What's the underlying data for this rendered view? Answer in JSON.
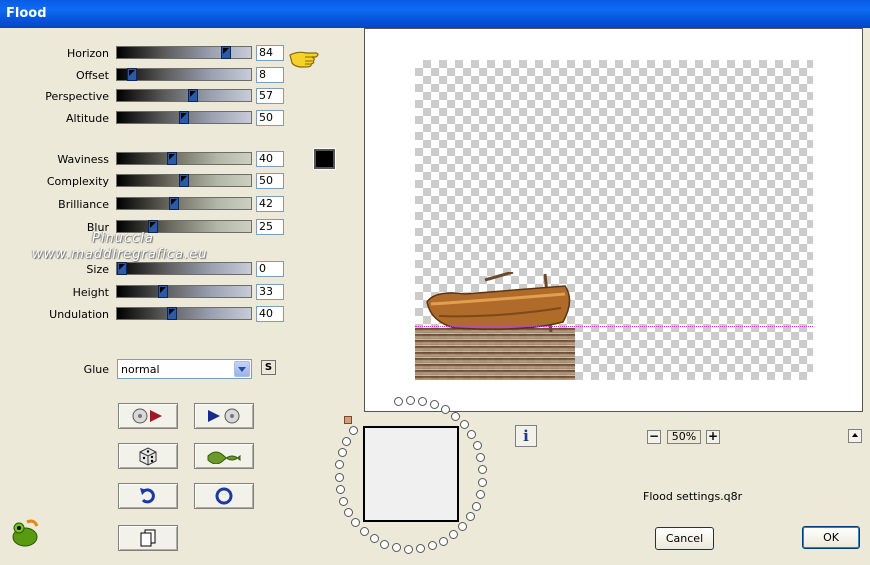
{
  "window": {
    "title": "Flood"
  },
  "sliders": [
    {
      "id": "horizon",
      "label": "Horizon",
      "value": "84"
    },
    {
      "id": "offset",
      "label": "Offset",
      "value": "8"
    },
    {
      "id": "perspective",
      "label": "Perspective",
      "value": "57"
    },
    {
      "id": "altitude",
      "label": "Altitude",
      "value": "50"
    },
    {
      "id": "waviness",
      "label": "Waviness",
      "value": "40"
    },
    {
      "id": "complexity",
      "label": "Complexity",
      "value": "50"
    },
    {
      "id": "brilliance",
      "label": "Brilliance",
      "value": "42"
    },
    {
      "id": "blur",
      "label": "Blur",
      "value": "25"
    },
    {
      "id": "size",
      "label": "Size",
      "value": "0"
    },
    {
      "id": "height",
      "label": "Height",
      "value": "33"
    },
    {
      "id": "undulation",
      "label": "Undulation",
      "value": "40"
    }
  ],
  "color_swatch": {
    "color": "#000000"
  },
  "watermark": {
    "line1": "Pinuccia",
    "line2": "www.maddiregrafica.eu"
  },
  "glue": {
    "label": "Glue",
    "value": "normal",
    "extra_button": "S"
  },
  "icons": [
    "load-preset-icon",
    "save-preset-icon",
    "random-dice-icon",
    "wave-icon",
    "undo-icon",
    "reset-icon",
    "copy-icon"
  ],
  "preview": {
    "zoom": "50%"
  },
  "info": {
    "label": "i"
  },
  "settings_file": "Flood settings.q8r",
  "buttons": {
    "cancel": "Cancel",
    "ok": "OK"
  }
}
